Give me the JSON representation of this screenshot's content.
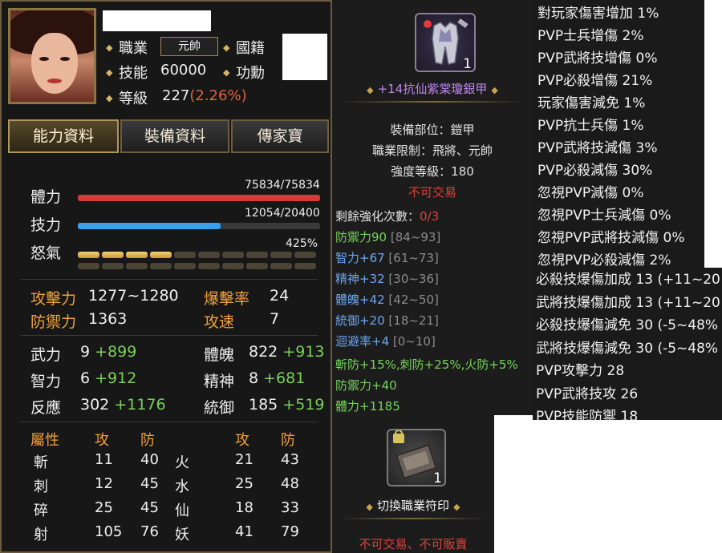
{
  "character": {
    "job_label": "職業",
    "job_value": "元帥",
    "nation_label": "國籍",
    "skill_label": "技能",
    "skill_value": "60000",
    "merit_label": "功勳",
    "level_label": "等級",
    "level_value": "227",
    "level_pct": "(2.26%)"
  },
  "tabs": [
    {
      "label": "能力資料"
    },
    {
      "label": "裝備資料"
    },
    {
      "label": "傳家寶"
    }
  ],
  "bars": {
    "hp": {
      "label": "體力",
      "text": "75834/75834",
      "current": 75834,
      "max": 75834
    },
    "mp": {
      "label": "技力",
      "text": "12054/20400",
      "current": 12054,
      "max": 20400
    },
    "rage": {
      "label": "怒氣",
      "text": "425%",
      "lit_segments": 4,
      "segments_per_row": 10
    }
  },
  "combat": {
    "attack_label": "攻擊力",
    "attack_value": "1277~1280",
    "crit_label": "爆擊率",
    "crit_value": "24",
    "defense_label": "防禦力",
    "defense_value": "1363",
    "speed_label": "攻速",
    "speed_value": "7"
  },
  "attributes": [
    {
      "label": "武力",
      "base": "9",
      "bonus": "+899"
    },
    {
      "label": "體魄",
      "base": "822",
      "bonus": "+913"
    },
    {
      "label": "智力",
      "base": "6",
      "bonus": "+912"
    },
    {
      "label": "精神",
      "base": "8",
      "bonus": "+681"
    },
    {
      "label": "反應",
      "base": "302",
      "bonus": "+1176"
    },
    {
      "label": "統御",
      "base": "185",
      "bonus": "+519"
    }
  ],
  "elements": {
    "headers": [
      "屬性",
      "攻",
      "防",
      "攻",
      "防"
    ],
    "rows": [
      {
        "name": "斬",
        "atk": "11",
        "def": "40",
        "name2": "火",
        "atk2": "21",
        "def2": "43"
      },
      {
        "name": "刺",
        "atk": "12",
        "def": "45",
        "name2": "水",
        "atk2": "25",
        "def2": "48"
      },
      {
        "name": "碎",
        "atk": "25",
        "def": "45",
        "name2": "仙",
        "atk2": "18",
        "def2": "33"
      },
      {
        "name": "射",
        "atk": "105",
        "def": "76",
        "name2": "妖",
        "atk2": "41",
        "def2": "79"
      }
    ]
  },
  "item": {
    "count": "1",
    "title": "+14抗仙紫棠瓊銀甲",
    "slot": "裝備部位：鎧甲",
    "job_limit": "職業限制：飛將、元帥",
    "strength": "強度等級：180",
    "tradable": "不可交易",
    "enhance_label": "剩餘強化次數：",
    "enhance_value": "0/3",
    "stats": [
      {
        "text": "防禦力90",
        "range": " [84~93]",
        "color": "green"
      },
      {
        "text": "智力+67",
        "range": " [61~73]",
        "color": "blue"
      },
      {
        "text": "精神+32",
        "range": " [30~36]",
        "color": "blue"
      },
      {
        "text": "體魄+42",
        "range": " [42~50]",
        "color": "blue"
      },
      {
        "text": "統御+20",
        "range": " [18~21]",
        "color": "blue"
      },
      {
        "text": "迴避率+4",
        "range": " [0~10]",
        "color": "blue"
      }
    ],
    "special": "斬防+15%,刺防+25%,火防+5%",
    "extra": [
      "防禦力+40",
      "體力+1185"
    ]
  },
  "pvp_top": [
    "對玩家傷害增加 1%",
    "PVP士兵增傷 2%",
    "PVP武將技增傷 0%",
    "PVP必殺增傷 21%",
    "玩家傷害減免 1%",
    "PVP抗士兵傷 1%",
    "PVP武將技減傷 3%",
    "PVP必殺減傷 30%",
    "忽視PVP減傷 0%",
    "忽視PVP士兵減傷 0%",
    "忽視PVP武將技減傷 0%",
    "忽視PVP必殺減傷 2%"
  ],
  "pvp_bottom": [
    "必殺技爆傷加成 13 (+11~20",
    "武將技爆傷加成 13 (+11~20",
    "必殺技爆傷減免 30 (-5~48%",
    "武將技爆傷減免 30 (-5~48%",
    "PVP攻擊力 28",
    "PVP武將技攻 26",
    "PVP技能防禦 18"
  ],
  "scroll": {
    "count": "1",
    "title": "切換職業符印",
    "restriction": "不可交易、不可販賣"
  },
  "colors": {
    "gold": "#f0a23a",
    "green": "#74d35a",
    "blue": "#6ea6f0",
    "red": "#e0403a",
    "purple": "#c084f0"
  }
}
